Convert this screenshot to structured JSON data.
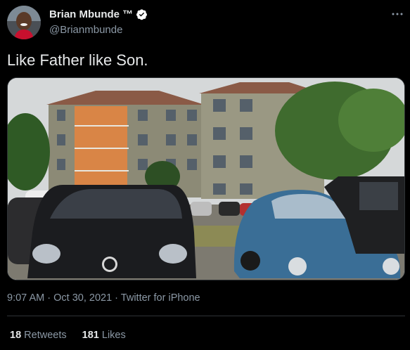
{
  "tweet": {
    "author": {
      "display_name": "Brian Mbunde ™",
      "handle": "@Brianmbunde",
      "verified": true
    },
    "more_icon": "more-dots-icon",
    "text": "Like Father like Son.",
    "media": {
      "alt": "Two Volkswagen cars parked in front of apartment buildings"
    },
    "time": "9:07 AM",
    "separator": "·",
    "date": "Oct 30, 2021",
    "source": "Twitter for iPhone",
    "retweets": {
      "count": "18",
      "label": "Retweets"
    },
    "likes": {
      "count": "181",
      "label": "Likes"
    }
  },
  "colors": {
    "background": "#000000",
    "primary_text": "#e7e9ea",
    "secondary_text": "#8b98a5",
    "verified": "#ffffff",
    "divider": "#2f3336"
  }
}
